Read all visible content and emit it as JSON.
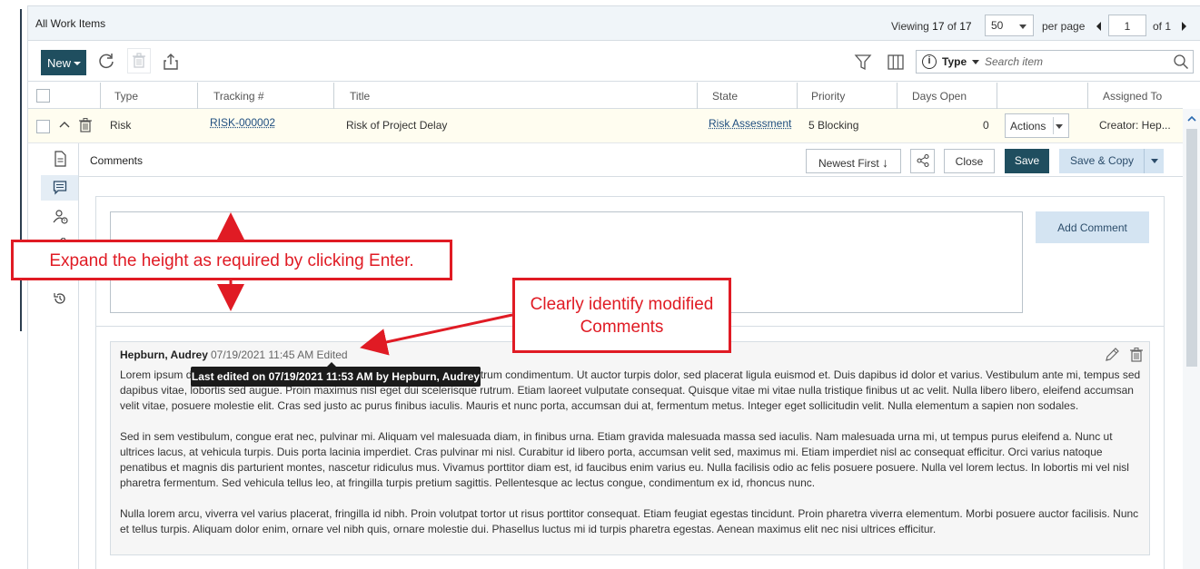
{
  "header": {
    "title": "All Work Items",
    "viewing_prefix": "Viewing",
    "viewing_count": "17",
    "viewing_of": "of",
    "viewing_total": "17",
    "page_size": "50",
    "per_page": "per page",
    "current_page": "1",
    "of_pages": "of 1"
  },
  "toolbar": {
    "new_label": "New",
    "type_label": "Type",
    "search_placeholder": "Search item"
  },
  "table": {
    "columns": [
      "Type",
      "Tracking #",
      "Title",
      "State",
      "Priority",
      "Days Open",
      "",
      "Assigned To"
    ],
    "row": {
      "type": "Risk",
      "tracking": "RISK-000002",
      "title": "Risk of Project Delay",
      "state": "Risk Assessment",
      "priority": "5 Blocking",
      "days_open": "0",
      "actions": "Actions",
      "assigned_to": "Creator: Hep..."
    }
  },
  "comments": {
    "header": "Comments",
    "sort_label": "Newest First",
    "close_label": "Close",
    "save_label": "Save",
    "save_copy_label": "Save & Copy",
    "add_comment_label": "Add Comment",
    "items": [
      {
        "author": "Hepburn, Audrey",
        "meta": "07/19/2021 11:45 AM Edited",
        "tooltip": "Last edited on 07/19/2021 11:53 AM by Hepburn, Audrey",
        "paragraphs": [
          "Lorem ipsum dolor sit amet, consectetur adipiscing elit. Nullam nec urna rutrum condimentum. Ut auctor turpis dolor, sed placerat ligula euismod et. Duis dapibus id dolor et varius. Vestibulum ante mi, tempus sed dapibus vitae, lobortis sed augue. Proin maximus nisl eget dui scelerisque rutrum. Etiam laoreet vulputate consequat. Quisque vitae mi vitae nulla tristique finibus ut ac velit. Nulla libero libero, eleifend accumsan velit vitae, posuere molestie elit. Cras sed justo ac purus finibus iaculis. Mauris et nunc porta, accumsan dui at, fermentum metus. Integer eget sollicitudin velit. Nulla elementum a sapien non sodales.",
          "Sed in sem vestibulum, congue erat nec, pulvinar mi. Aliquam vel malesuada diam, in finibus urna. Etiam gravida malesuada massa sed iaculis. Nam malesuada urna mi, ut tempus purus eleifend a. Nunc ut ultrices lacus, at vehicula turpis. Duis porta lacinia imperdiet. Cras pulvinar mi nisl. Curabitur id libero porta, accumsan velit sed, maximus mi. Etiam imperdiet nisl ac consequat efficitur. Orci varius natoque penatibus et magnis dis parturient montes, nascetur ridiculus mus. Vivamus porttitor diam est, id faucibus enim varius eu. Nulla facilisis odio ac felis posuere posuere. Nulla vel lorem lectus. In lobortis mi vel nisl pharetra fermentum. Sed vehicula tellus leo, at fringilla turpis pretium sagittis. Pellentesque ac lectus congue, condimentum ex id, rhoncus nunc.",
          "Nulla lorem arcu, viverra vel varius placerat, fringilla id nibh. Proin volutpat tortor ut risus porttitor consequat. Etiam feugiat egestas tincidunt. Proin pharetra viverra elementum. Morbi posuere auctor facilisis. Nunc et tellus turpis. Aliquam dolor enim, ornare vel nibh quis, ornare molestie dui. Phasellus luctus mi id turpis pharetra egestas. Aenean maximus elit nec nisi ultrices efficitur."
        ]
      }
    ]
  },
  "callouts": {
    "expand": "Expand the height as required by clicking Enter.",
    "modified_line1": "Clearly identify modified",
    "modified_line2": "Comments"
  },
  "colors": {
    "primary": "#1f4e5f",
    "secondary_button": "#d4e4f2",
    "annotation_red": "#e01b24",
    "row_highlight": "#fffdf0"
  }
}
